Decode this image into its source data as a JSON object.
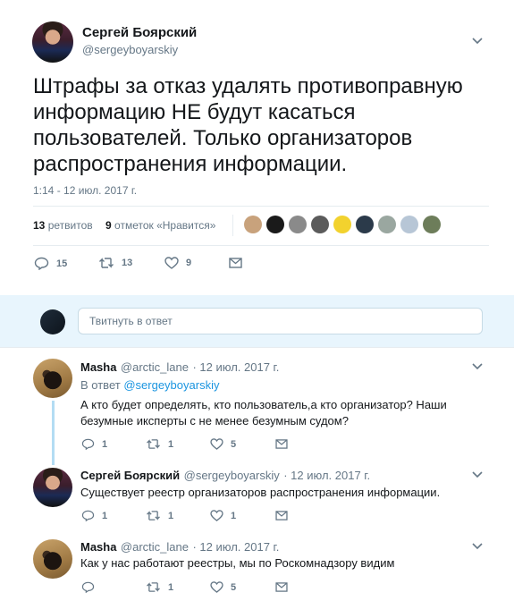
{
  "main_tweet": {
    "author_name": "Сергей Боярский",
    "author_handle": "@sergeyboyarskiy",
    "text": "Штрафы за отказ удалять противоправную информацию НЕ будут касаться пользователей. Только организаторов распространения информации.",
    "timestamp": "1:14 - 12 июл. 2017 г.",
    "retweets_count": "13",
    "retweets_label": "ретвитов",
    "likes_count": "9",
    "likes_label": "отметок «Нравится»",
    "actions": {
      "replies": "15",
      "retweets": "13",
      "likes": "9"
    },
    "likers_colors": [
      "#c8a27c",
      "#1a1a1a",
      "#8a8a8a",
      "#5b5b5b",
      "#f2d22e",
      "#2b3a4a",
      "#9aa7a0",
      "#b7c6d6",
      "#6d7d5a"
    ]
  },
  "composer": {
    "placeholder": "Твитнуть в ответ"
  },
  "replies": [
    {
      "author_name": "Masha",
      "author_handle": "@arctic_lane",
      "date": "· 12 июл. 2017 г.",
      "reply_to_prefix": "В ответ",
      "reply_to_handle": "@sergeyboyarskiy",
      "text": "А кто будет определять, кто пользователь,а кто организатор? Наши безумные иксперты с не менее безумным судом?",
      "actions": {
        "replies": "1",
        "retweets": "1",
        "likes": "5"
      }
    },
    {
      "author_name": "Сергей Боярский",
      "author_handle": "@sergeyboyarskiy",
      "date": "· 12 июл. 2017 г.",
      "text": "Существует реестр организаторов распространения информации.",
      "actions": {
        "replies": "1",
        "retweets": "1",
        "likes": "1"
      }
    },
    {
      "author_name": "Masha",
      "author_handle": "@arctic_lane",
      "date": "· 12 июл. 2017 г.",
      "text": "Как у нас работают реестры, мы по Роскомнадзору видим",
      "actions": {
        "replies": "",
        "retweets": "1",
        "likes": "5"
      }
    }
  ],
  "colors": {
    "accent": "#1b95e0",
    "text": "#14171a",
    "muted": "#657786",
    "thread_line": "#b3dcf3"
  }
}
